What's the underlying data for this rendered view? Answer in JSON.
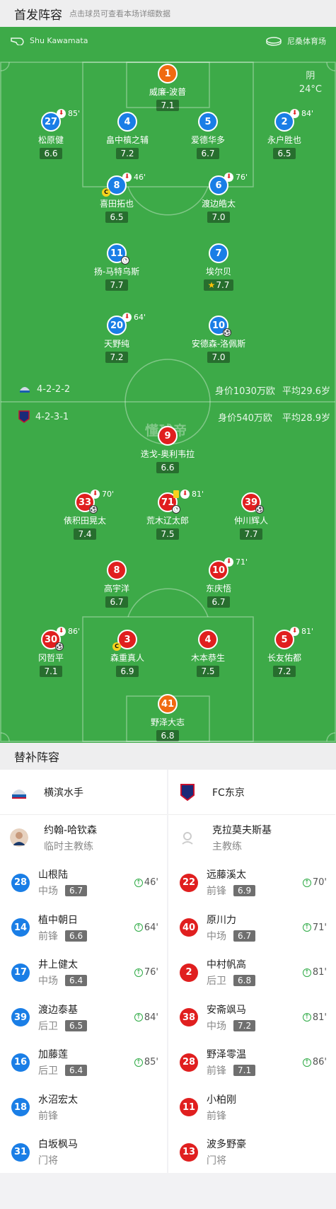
{
  "header": {
    "title": "首发阵容",
    "hint": "点击球员可查看本场详细数据"
  },
  "referee": "Shu Kawamata",
  "venue": "尼桑体育场",
  "weather": {
    "condition": "阴",
    "temp": "24°C"
  },
  "home_team": {
    "name": "横滨水手",
    "formation": "4-2-2-2",
    "value": "身价1030万欧",
    "avg_age": "平均29.6岁",
    "players": [
      {
        "num": "1",
        "name": "威廉-波普",
        "rating": "7.1",
        "role": "gk"
      },
      {
        "num": "27",
        "name": "松原健",
        "rating": "6.6",
        "sub": "85'"
      },
      {
        "num": "4",
        "name": "畠中槙之辅",
        "rating": "7.2"
      },
      {
        "num": "5",
        "name": "爱德华多",
        "rating": "6.7"
      },
      {
        "num": "2",
        "name": "永户胜也",
        "rating": "6.5",
        "sub": "84'"
      },
      {
        "num": "8",
        "name": "喜田拓也",
        "rating": "6.5",
        "sub": "46'",
        "captain": true
      },
      {
        "num": "6",
        "name": "渡边皓太",
        "rating": "7.0",
        "sub": "76'"
      },
      {
        "num": "11",
        "name": "扬-马特乌斯",
        "rating": "7.7",
        "assist": true
      },
      {
        "num": "7",
        "name": "埃尔贝",
        "rating": "7.7",
        "mvp": true
      },
      {
        "num": "20",
        "name": "天野纯",
        "rating": "7.2",
        "sub": "64'"
      },
      {
        "num": "10",
        "name": "安德森-洛佩斯",
        "rating": "7.0",
        "goal": true
      }
    ]
  },
  "away_team": {
    "name": "FC东京",
    "formation": "4-2-3-1",
    "value": "身价540万欧",
    "avg_age": "平均28.9岁",
    "players": [
      {
        "num": "9",
        "name": "迭戈-奥利韦拉",
        "rating": "6.6"
      },
      {
        "num": "33",
        "name": "俵积田晃太",
        "rating": "7.4",
        "sub": "70'",
        "goal": true
      },
      {
        "num": "71",
        "name": "荒木辽太郎",
        "rating": "7.5",
        "sub": "81'",
        "yellow": true,
        "assist": true
      },
      {
        "num": "39",
        "name": "仲川辉人",
        "rating": "7.7",
        "goal": true
      },
      {
        "num": "8",
        "name": "高宇洋",
        "rating": "6.7"
      },
      {
        "num": "10",
        "name": "东庆悟",
        "rating": "6.7",
        "sub": "71'"
      },
      {
        "num": "30",
        "name": "冈哲平",
        "rating": "7.1",
        "sub": "86'",
        "goal": true
      },
      {
        "num": "3",
        "name": "森重真人",
        "rating": "6.9",
        "captain": true
      },
      {
        "num": "4",
        "name": "木本恭生",
        "rating": "7.5"
      },
      {
        "num": "5",
        "name": "长友佑都",
        "rating": "7.2",
        "sub": "81'"
      },
      {
        "num": "41",
        "name": "野泽大志",
        "rating": "6.8",
        "role": "gk"
      }
    ]
  },
  "watermark": "懂球帝",
  "subs_title": "替补阵容",
  "subs_left": {
    "team": "横滨水手",
    "coach": {
      "name": "约翰-哈钦森",
      "role": "临时主教练"
    },
    "players": [
      {
        "num": "28",
        "name": "山根陆",
        "pos": "中场",
        "rating": "6.7",
        "in": "46'"
      },
      {
        "num": "14",
        "name": "植中朝日",
        "pos": "前锋",
        "rating": "6.6",
        "in": "64'"
      },
      {
        "num": "17",
        "name": "井上健太",
        "pos": "中场",
        "rating": "6.4",
        "in": "76'"
      },
      {
        "num": "39",
        "name": "渡边泰基",
        "pos": "后卫",
        "rating": "6.5",
        "in": "84'"
      },
      {
        "num": "16",
        "name": "加藤莲",
        "pos": "后卫",
        "rating": "6.4",
        "in": "85'"
      },
      {
        "num": "18",
        "name": "水沼宏太",
        "pos": "前锋"
      },
      {
        "num": "31",
        "name": "白坂枫马",
        "pos": "门将"
      }
    ]
  },
  "subs_right": {
    "team": "FC东京",
    "coach": {
      "name": "克拉莫夫斯基",
      "role": "主教练"
    },
    "players": [
      {
        "num": "22",
        "name": "远藤溪太",
        "pos": "前锋",
        "rating": "6.9",
        "in": "70'"
      },
      {
        "num": "40",
        "name": "原川力",
        "pos": "中场",
        "rating": "6.7",
        "in": "71'"
      },
      {
        "num": "2",
        "name": "中村帆高",
        "pos": "后卫",
        "rating": "6.8",
        "in": "81'"
      },
      {
        "num": "38",
        "name": "安斋飒马",
        "pos": "中场",
        "rating": "7.2",
        "in": "81'"
      },
      {
        "num": "28",
        "name": "野泽零温",
        "pos": "前锋",
        "rating": "7.1",
        "in": "86'"
      },
      {
        "num": "11",
        "name": "小柏刚",
        "pos": "前锋"
      },
      {
        "num": "13",
        "name": "波多野豪",
        "pos": "门将"
      }
    ]
  }
}
